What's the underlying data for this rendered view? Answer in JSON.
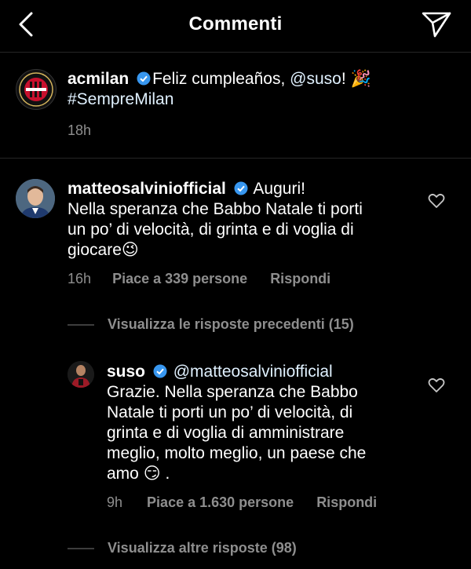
{
  "header": {
    "title": "Commenti"
  },
  "caption": {
    "username": "acmilan",
    "text_prefix": "Feliz cumpleaños, ",
    "mention": "@suso",
    "text_suffix": "!",
    "emoji": "🎉",
    "hashtag": "#SempreMilan",
    "time": "18h"
  },
  "comment": {
    "username": "matteosalviniofficial",
    "text_first": "Auguri!",
    "line2": "Nella speranza che Babbo Natale ti porti",
    "line3": "un po’ di velocità, di grinta e di voglia di",
    "line4": "giocare",
    "emoji": "😉",
    "time": "16h",
    "likes": "Piace a 339 persone",
    "reply": "Rispondi",
    "view_previous": "Visualizza le risposte precedenti (15)"
  },
  "reply": {
    "username": "suso",
    "mention": "@matteosalviniofficial",
    "line2": "Grazie. Nella speranza che Babbo",
    "line3": "Natale ti porti un po’ di velocità, di",
    "line4": "grinta e di voglia di amministrare",
    "line5": "meglio, molto meglio, un paese che",
    "line6_prefix": "amo",
    "line6_suffix": ".",
    "emoji": "😏",
    "time": "9h",
    "likes": "Piace a 1.630 persone",
    "reply": "Rispondi",
    "view_more": "Visualizza altre risposte (98)"
  },
  "icons": {
    "back": "chevron-left-icon",
    "send": "paper-plane-icon",
    "verified": "verified-badge-icon",
    "like": "heart-icon"
  },
  "colors": {
    "verified": "#3897f0",
    "milan_red": "#c8102e"
  }
}
